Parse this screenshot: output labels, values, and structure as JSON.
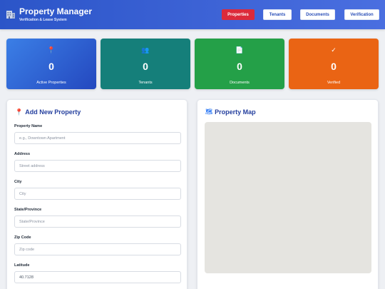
{
  "header": {
    "title": "Property Manager",
    "subtitle": "Verification & Lease System",
    "nav": [
      {
        "label": "Properties",
        "active": true
      },
      {
        "label": "Tenants",
        "active": false
      },
      {
        "label": "Documents",
        "active": false
      },
      {
        "label": "Verification",
        "active": false
      }
    ]
  },
  "stats": [
    {
      "icon": "📍",
      "icon_name": "pin-icon",
      "value": "0",
      "label": "Active Properties",
      "color": "#2f5fd3"
    },
    {
      "icon": "👥",
      "icon_name": "users-icon",
      "value": "0",
      "label": "Tenants",
      "color": "#157f7a"
    },
    {
      "icon": "📄",
      "icon_name": "document-icon",
      "value": "0",
      "label": "Documents",
      "color": "#24a048"
    },
    {
      "icon": "✓",
      "icon_name": "check-icon",
      "value": "0",
      "label": "Verified",
      "color": "#ea6414"
    }
  ],
  "form": {
    "title": "Add New Property",
    "fields": [
      {
        "label": "Property Name",
        "placeholder": "e.g., Downtown Apartment",
        "value": ""
      },
      {
        "label": "Address",
        "placeholder": "Street address",
        "value": ""
      },
      {
        "label": "City",
        "placeholder": "City",
        "value": ""
      },
      {
        "label": "State/Province",
        "placeholder": "State/Province",
        "value": ""
      },
      {
        "label": "Zip Code",
        "placeholder": "Zip code",
        "value": ""
      },
      {
        "label": "Latitude",
        "placeholder": "",
        "value": "40.7128"
      }
    ]
  },
  "map": {
    "title": "Property Map"
  },
  "colors": {
    "header": "#3458cf",
    "active_nav": "#dc2a3a",
    "panel_title": "#243f9e",
    "map_bg": "#e5e4e0"
  }
}
